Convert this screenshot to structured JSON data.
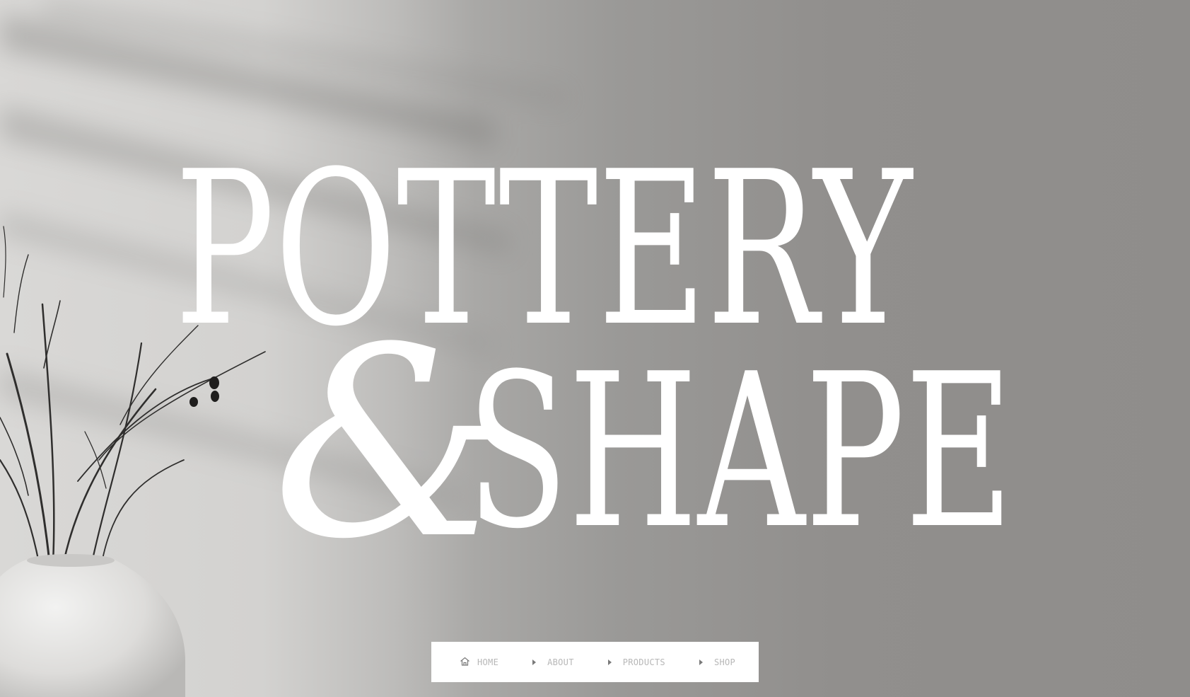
{
  "hero": {
    "line1": "POTTERY",
    "line2": "SHAPE"
  },
  "nav": {
    "items": [
      {
        "label": "HOME",
        "icon": "home-icon"
      },
      {
        "label": "ABOUT",
        "icon": "caret-right-icon"
      },
      {
        "label": "PRODUCTS",
        "icon": "caret-right-icon"
      },
      {
        "label": "SHOP",
        "icon": "caret-right-icon"
      }
    ]
  },
  "colors": {
    "background_light": "#d9d8d6",
    "background_dark": "#8f8d8b",
    "title": "#ffffff",
    "nav_background": "#ffffff",
    "nav_text": "#b7b7b7"
  }
}
